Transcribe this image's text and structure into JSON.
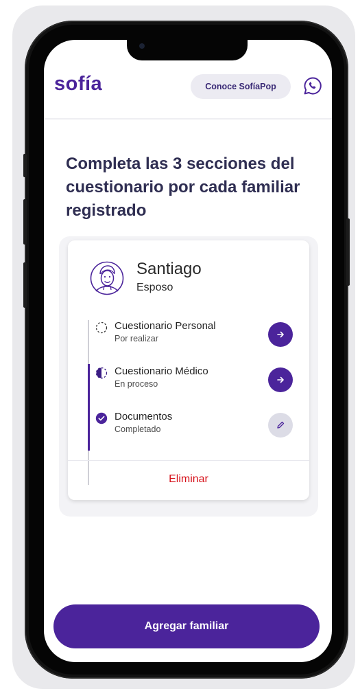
{
  "header": {
    "logo_text": "sofía",
    "cta_label": "Conoce SofíaPop"
  },
  "main": {
    "title": "Completa las 3 secciones del cuestionario por cada familiar registrado"
  },
  "family_card": {
    "name": "Santiago",
    "relation": "Esposo",
    "steps": [
      {
        "title": "Cuestionario Personal",
        "status": "Por realizar",
        "icon": "dashed-circle-icon",
        "action_icon": "arrow-right-icon"
      },
      {
        "title": "Cuestionario Médico",
        "status": "En proceso",
        "icon": "half-circle-icon",
        "action_icon": "arrow-right-icon"
      },
      {
        "title": "Documentos",
        "status": "Completado",
        "icon": "check-circle-icon",
        "action_icon": "pencil-icon"
      }
    ],
    "delete_label": "Eliminar"
  },
  "footer": {
    "add_label": "Agregar familiar"
  },
  "colors": {
    "brand": "#4b249b",
    "danger": "#d6111a",
    "title": "#2f2e52"
  }
}
